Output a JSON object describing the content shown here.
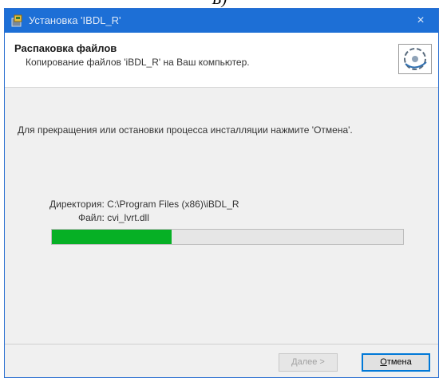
{
  "caption": "Б)",
  "window": {
    "title": "Установка 'IBDL_R'",
    "close_glyph": "×",
    "title_icon": "installer-icon",
    "titlebar_color": "#1d6fd6"
  },
  "header": {
    "title": "Распаковка файлов",
    "subtitle": "Копирование файлов 'iBDL_R' на Ваш компьютер.",
    "logo_icon": "disk-logo-icon"
  },
  "body": {
    "instruction": "Для прекращения или остановки процесса инсталляции нажмите 'Отмена'.",
    "directory_label": "Директория:",
    "directory_value": "C:\\Program Files (x86)\\iBDL_R",
    "file_label": "Файл:",
    "file_value": "cvi_lvrt.dll",
    "progress_fraction": 0.34,
    "progress_color": "#06b025"
  },
  "footer": {
    "next_label": "Далее >",
    "cancel_accel": "О",
    "cancel_rest": "тмена"
  }
}
